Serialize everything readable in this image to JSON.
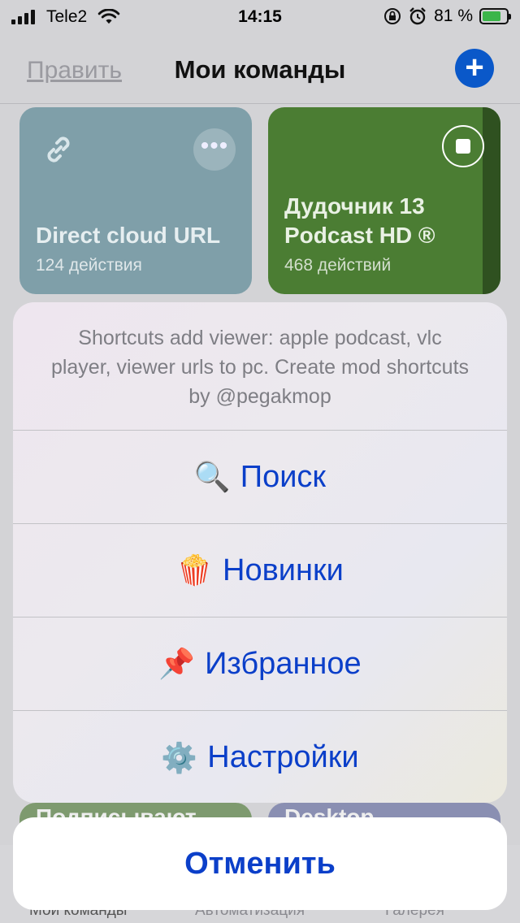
{
  "status": {
    "carrier": "Tele2",
    "time": "14:15",
    "battery": "81 %",
    "battery_level": 0.81
  },
  "nav": {
    "edit": "Править",
    "title": "Мои команды",
    "add": "+"
  },
  "cards": [
    {
      "title": "Direct cloud URL",
      "subtitle": "124 действия",
      "color": "#7f9fa9"
    },
    {
      "title": "Дудочник 13 Podcast HD ®",
      "subtitle": "468 действий",
      "color": "#4b7d33"
    }
  ],
  "peek_cards": [
    "Подписывают",
    "Desktop"
  ],
  "sheet": {
    "message": "Shortcuts add viewer: apple podcast, vlc player, viewer urls to pc. Create mod shortcuts by @pegakmop",
    "items": [
      {
        "emoji": "🔍",
        "label": "Поиск"
      },
      {
        "emoji": "🍿",
        "label": "Новинки"
      },
      {
        "emoji": "📌",
        "label": "Избранное"
      },
      {
        "emoji": "⚙️",
        "label": "Настройки"
      }
    ],
    "cancel": "Отменить"
  },
  "tabs": [
    "Мои команды",
    "Автоматизация",
    "Галерея"
  ],
  "colors": {
    "accent": "#0b3fc9",
    "add_button": "#0a58c9"
  }
}
